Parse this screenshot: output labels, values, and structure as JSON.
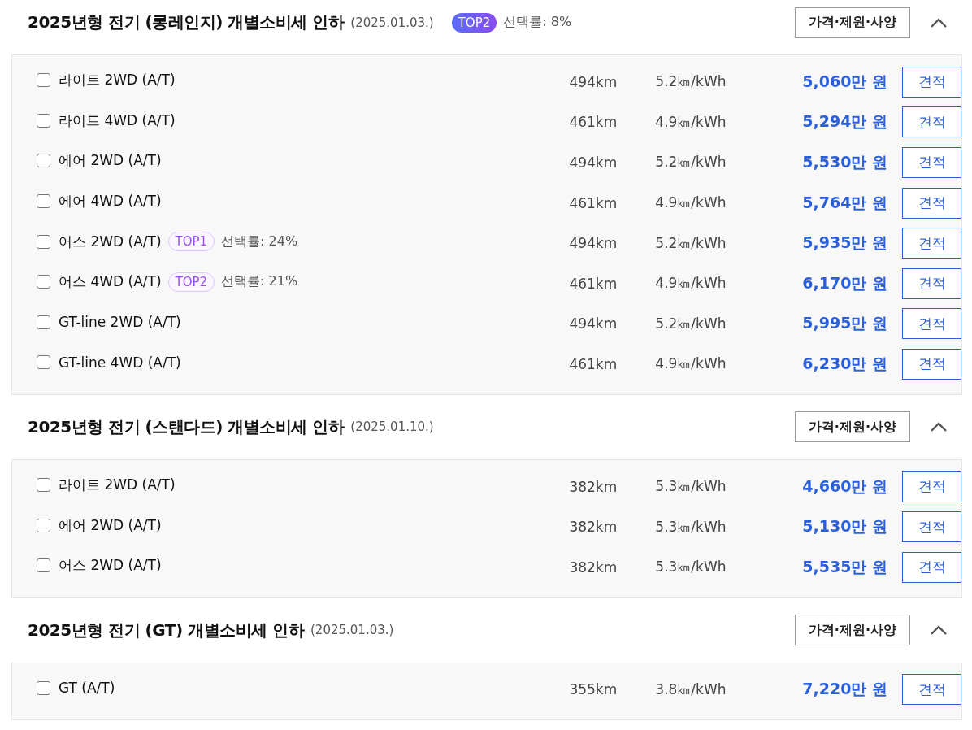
{
  "sections": [
    {
      "title": "2025년형 전기 (롱레인지) 개별소비세 인하",
      "date": "(2025.01.03.)",
      "badge": "TOP2",
      "rate": "선택률: 8%",
      "spec_button": "가격·제원·사양",
      "expanded": true,
      "trims": [
        {
          "name": "라이트 2WD (A/T)",
          "checked": false,
          "range": "494km",
          "efficiency": "5.2㎞/kWh",
          "price": "5,060만 원",
          "button": "견적"
        },
        {
          "name": "라이트 4WD (A/T)",
          "checked": false,
          "range": "461km",
          "efficiency": "4.9㎞/kWh",
          "price": "5,294만 원",
          "button": "견적"
        },
        {
          "name": "에어 2WD (A/T)",
          "checked": false,
          "range": "494km",
          "efficiency": "5.2㎞/kWh",
          "price": "5,530만 원",
          "button": "견적"
        },
        {
          "name": "에어 4WD (A/T)",
          "checked": false,
          "range": "461km",
          "efficiency": "4.9㎞/kWh",
          "price": "5,764만 원",
          "button": "견적"
        },
        {
          "name": "어스 2WD (A/T)",
          "checked": false,
          "badge": "TOP1",
          "rate": "선택률: 24%",
          "range": "494km",
          "efficiency": "5.2㎞/kWh",
          "price": "5,935만 원",
          "button": "견적"
        },
        {
          "name": "어스 4WD (A/T)",
          "checked": false,
          "badge": "TOP2",
          "rate": "선택률: 21%",
          "range": "461km",
          "efficiency": "4.9㎞/kWh",
          "price": "6,170만 원",
          "button": "견적"
        },
        {
          "name": "GT-line 2WD (A/T)",
          "checked": false,
          "range": "494km",
          "efficiency": "5.2㎞/kWh",
          "price": "5,995만 원",
          "button": "견적"
        },
        {
          "name": "GT-line 4WD (A/T)",
          "checked": false,
          "range": "461km",
          "efficiency": "4.9㎞/kWh",
          "price": "6,230만 원",
          "button": "견적"
        }
      ]
    },
    {
      "title": "2025년형 전기 (스탠다드) 개별소비세 인하",
      "date": "(2025.01.10.)",
      "spec_button": "가격·제원·사양",
      "expanded": true,
      "trims": [
        {
          "name": "라이트 2WD (A/T)",
          "checked": false,
          "range": "382km",
          "efficiency": "5.3㎞/kWh",
          "price": "4,660만 원",
          "button": "견적"
        },
        {
          "name": "에어 2WD (A/T)",
          "checked": false,
          "range": "382km",
          "efficiency": "5.3㎞/kWh",
          "price": "5,130만 원",
          "button": "견적"
        },
        {
          "name": "어스 2WD (A/T)",
          "checked": false,
          "range": "382km",
          "efficiency": "5.3㎞/kWh",
          "price": "5,535만 원",
          "button": "견적"
        }
      ]
    },
    {
      "title": "2025년형 전기 (GT) 개별소비세 인하",
      "date": "(2025.01.03.)",
      "spec_button": "가격·제원·사양",
      "expanded": true,
      "trims": [
        {
          "name": "GT (A/T)",
          "checked": false,
          "range": "355km",
          "efficiency": "3.8㎞/kWh",
          "price": "7,220만 원",
          "button": "견적"
        }
      ]
    }
  ]
}
